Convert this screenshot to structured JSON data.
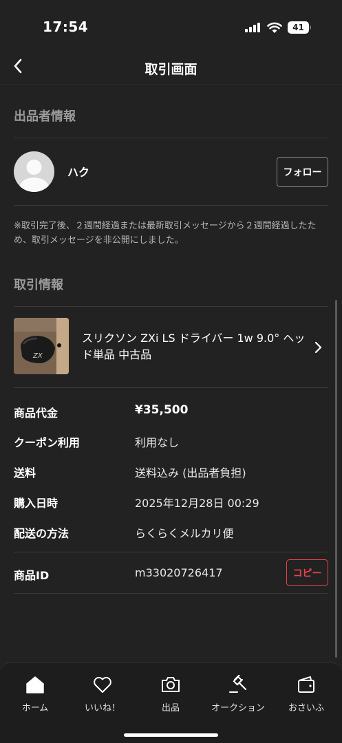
{
  "status_bar": {
    "time": "17:54",
    "battery": "41"
  },
  "nav": {
    "title": "取引画面"
  },
  "seller_section": {
    "header": "出品者情報",
    "seller_name": "ハク",
    "follow_label": "フォロー"
  },
  "notice": "※取引完了後、２週間経過または最新取引メッセージから２週間経過したため、取引メッセージを非公開にしました。",
  "trade_section": {
    "header": "取引情報"
  },
  "product": {
    "title": "スリクソン ZXi LS ドライバー 1w 9.0° ヘッド単品 中古品"
  },
  "details": [
    {
      "label": "商品代金",
      "value": "¥35,500"
    },
    {
      "label": "クーポン利用",
      "value": "利用なし"
    },
    {
      "label": "送料",
      "value": "送料込み (出品者負担)"
    },
    {
      "label": "購入日時",
      "value": "2025年12月28日 00:29"
    },
    {
      "label": "配送の方法",
      "value": "らくらくメルカリ便"
    }
  ],
  "item_id": {
    "label": "商品ID",
    "value": "m33020726417",
    "copy_label": "コピー"
  },
  "tabs": [
    {
      "label": "ホーム",
      "icon": "home-icon"
    },
    {
      "label": "いいね！",
      "icon": "heart-icon"
    },
    {
      "label": "出品",
      "icon": "camera-icon"
    },
    {
      "label": "オークション",
      "icon": "gavel-icon"
    },
    {
      "label": "おさいふ",
      "icon": "wallet-icon"
    }
  ],
  "colors": {
    "background": "#222222",
    "accent_red": "#e8434a",
    "muted_text": "#9a9a9a"
  }
}
